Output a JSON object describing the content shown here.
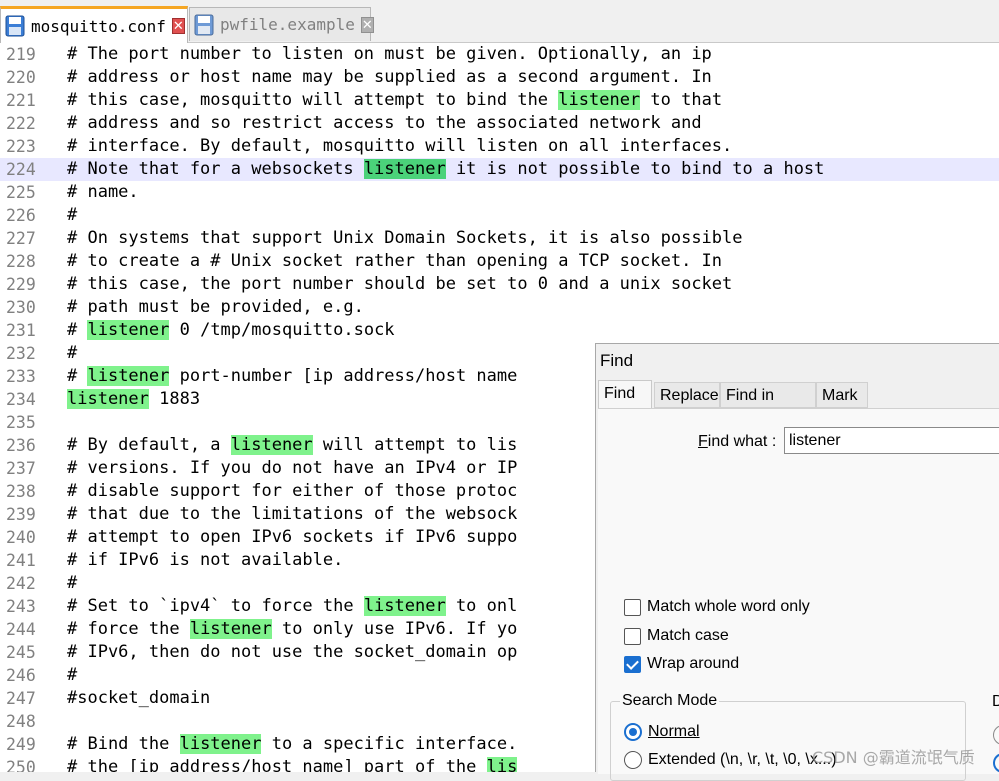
{
  "tabs": [
    {
      "label": "mosquitto.conf",
      "active": true,
      "close": "✕"
    },
    {
      "label": "pwfile.example",
      "active": false,
      "close": "✕"
    }
  ],
  "editor": {
    "lines": [
      {
        "num": "219",
        "segments": [
          {
            "t": "# The port number to listen on must be given. Optionally, an ip"
          }
        ]
      },
      {
        "num": "220",
        "segments": [
          {
            "t": "# address or host name may be supplied as a second argument. In"
          }
        ]
      },
      {
        "num": "221",
        "segments": [
          {
            "t": "# this case, mosquitto will attempt to bind the "
          },
          {
            "t": "listener",
            "hl": true
          },
          {
            "t": " to that"
          }
        ]
      },
      {
        "num": "222",
        "segments": [
          {
            "t": "# address and so restrict access to the associated network and"
          }
        ]
      },
      {
        "num": "223",
        "segments": [
          {
            "t": "# interface. By default, mosquitto will listen on all interfaces."
          }
        ]
      },
      {
        "num": "224",
        "current": true,
        "segments": [
          {
            "t": "# Note that for a websockets "
          },
          {
            "t": "listener",
            "hl": true,
            "cur": true
          },
          {
            "t": " it is not possible to bind to a host"
          }
        ]
      },
      {
        "num": "225",
        "segments": [
          {
            "t": "# name."
          }
        ]
      },
      {
        "num": "226",
        "segments": [
          {
            "t": "#"
          }
        ]
      },
      {
        "num": "227",
        "segments": [
          {
            "t": "# On systems that support Unix Domain Sockets, it is also possible"
          }
        ]
      },
      {
        "num": "228",
        "segments": [
          {
            "t": "# to create a # Unix socket rather than opening a TCP socket. In"
          }
        ]
      },
      {
        "num": "229",
        "segments": [
          {
            "t": "# this case, the port number should be set to 0 and a unix socket"
          }
        ]
      },
      {
        "num": "230",
        "segments": [
          {
            "t": "# path must be provided, e.g."
          }
        ]
      },
      {
        "num": "231",
        "segments": [
          {
            "t": "# "
          },
          {
            "t": "listener",
            "hl": true
          },
          {
            "t": " 0 /tmp/mosquitto.sock"
          }
        ]
      },
      {
        "num": "232",
        "segments": [
          {
            "t": "#"
          }
        ]
      },
      {
        "num": "233",
        "segments": [
          {
            "t": "# "
          },
          {
            "t": "listener",
            "hl": true
          },
          {
            "t": " port-number [ip address/host name"
          }
        ]
      },
      {
        "num": "234",
        "segments": [
          {
            "t": "listener",
            "hl": true
          },
          {
            "t": " 1883"
          }
        ]
      },
      {
        "num": "235",
        "segments": [
          {
            "t": ""
          }
        ]
      },
      {
        "num": "236",
        "segments": [
          {
            "t": "# By default, a "
          },
          {
            "t": "listener",
            "hl": true
          },
          {
            "t": " will attempt to lis"
          }
        ]
      },
      {
        "num": "237",
        "segments": [
          {
            "t": "# versions. If you do not have an IPv4 or IP"
          }
        ]
      },
      {
        "num": "238",
        "segments": [
          {
            "t": "# disable support for either of those protoc"
          }
        ]
      },
      {
        "num": "239",
        "segments": [
          {
            "t": "# that due to the limitations of the websock"
          }
        ]
      },
      {
        "num": "240",
        "segments": [
          {
            "t": "# attempt to open IPv6 sockets if IPv6 suppo"
          }
        ]
      },
      {
        "num": "241",
        "segments": [
          {
            "t": "# if IPv6 is not available."
          }
        ]
      },
      {
        "num": "242",
        "segments": [
          {
            "t": "#"
          }
        ]
      },
      {
        "num": "243",
        "segments": [
          {
            "t": "# Set to `ipv4` to force the "
          },
          {
            "t": "listener",
            "hl": true
          },
          {
            "t": " to onl"
          }
        ]
      },
      {
        "num": "244",
        "segments": [
          {
            "t": "# force the "
          },
          {
            "t": "listener",
            "hl": true
          },
          {
            "t": " to only use IPv6. If yo"
          }
        ]
      },
      {
        "num": "245",
        "segments": [
          {
            "t": "# IPv6, then do not use the socket_domain op"
          }
        ]
      },
      {
        "num": "246",
        "segments": [
          {
            "t": "#"
          }
        ]
      },
      {
        "num": "247",
        "segments": [
          {
            "t": "#socket_domain"
          }
        ]
      },
      {
        "num": "248",
        "segments": [
          {
            "t": ""
          }
        ]
      },
      {
        "num": "249",
        "segments": [
          {
            "t": "# Bind the "
          },
          {
            "t": "listener",
            "hl": true
          },
          {
            "t": " to a specific interface."
          }
        ]
      },
      {
        "num": "250",
        "segments": [
          {
            "t": "# the [ip address/host name] part of the "
          },
          {
            "t": "lis",
            "hl": true
          }
        ]
      }
    ]
  },
  "find_dialog": {
    "title": "Find",
    "tabs": [
      "Find",
      "Replace",
      "Find in Files",
      "Mark"
    ],
    "find_what_label": "Find what :",
    "find_what_value": "listener",
    "options": [
      {
        "label": "Match whole word only",
        "checked": false
      },
      {
        "label": "Match case",
        "checked": false
      },
      {
        "label": "Wrap around",
        "checked": true
      }
    ],
    "search_mode_label": "Search Mode",
    "search_modes": [
      {
        "label": "Normal",
        "selected": true
      },
      {
        "label": "Extended (\\n, \\r, \\t, \\0, \\x...)",
        "selected": false
      }
    ],
    "direction_label_fragment": "D"
  },
  "watermark": "CSDN @霸道流氓气质",
  "colors": {
    "highlight": "#7ff28c",
    "highlight_current": "#4bd27a",
    "current_line": "#e8e8ff",
    "line_number": "#808080",
    "accent": "#1a6fd0"
  }
}
